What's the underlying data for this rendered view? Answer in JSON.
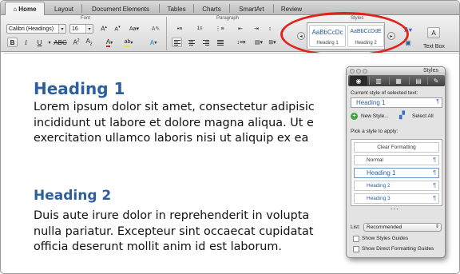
{
  "ribbon": {
    "tabs": [
      {
        "label": "Home",
        "active": true
      },
      {
        "label": "Layout"
      },
      {
        "label": "Document Elements"
      },
      {
        "label": "Tables"
      },
      {
        "label": "Charts"
      },
      {
        "label": "SmartArt"
      },
      {
        "label": "Review"
      }
    ],
    "groups": {
      "font": "Font",
      "paragraph": "Paragraph",
      "styles": "Styles"
    },
    "font_name": "Calibri (Headings)",
    "font_size": "16",
    "bold_label": "B",
    "italic_label": "I",
    "underline_label": "U",
    "text_box_label": "Text Box",
    "style_gallery": [
      {
        "sample": "AaBbCcDc",
        "label": "Heading 1"
      },
      {
        "sample": "AaBbCcDdE",
        "label": "Heading 2"
      }
    ]
  },
  "document": {
    "heading1": "Heading 1",
    "para1": [
      "Lorem ipsum dolor sit amet, consectetur adipisic",
      "incididunt ut labore et dolore magna aliqua. Ut e",
      "exercitation ullamco laboris nisi ut aliquip ex ea"
    ],
    "heading2": "Heading 2",
    "para2": [
      "Duis aute irure dolor in reprehenderit in volupta",
      "nulla pariatur. Excepteur sint occaecat cupidatat",
      "officia deserunt mollit anim id est laborum."
    ]
  },
  "palette": {
    "title": "Styles",
    "current_label": "Current style of selected text:",
    "current_value": "Heading 1",
    "new_style": "New Style...",
    "select_all": "Select All",
    "pick_label": "Pick a style to apply:",
    "styles": [
      {
        "label": "Clear Formatting",
        "selected": false
      },
      {
        "label": "Normal",
        "selected": false
      },
      {
        "label": "Heading 1",
        "selected": true
      },
      {
        "label": "Heading 2",
        "selected": false
      },
      {
        "label": "Heading 3",
        "selected": false
      }
    ],
    "list_label": "List:",
    "list_value": "Recommended",
    "show_guides": "Show Styles Guides",
    "show_direct": "Show Direct Formatting Guides"
  },
  "colors": {
    "heading": "#2d5f9e",
    "highlight_ring": "#e0241c",
    "accent_blue": "#4a7bd0"
  },
  "icons": [
    "home-icon",
    "bold-icon",
    "italic-icon",
    "underline-icon",
    "align-left-icon",
    "align-center-icon",
    "align-right-icon",
    "justify-icon",
    "pilcrow-icon",
    "new-style-icon",
    "select-all-icon",
    "styles-toolbar-icon"
  ]
}
